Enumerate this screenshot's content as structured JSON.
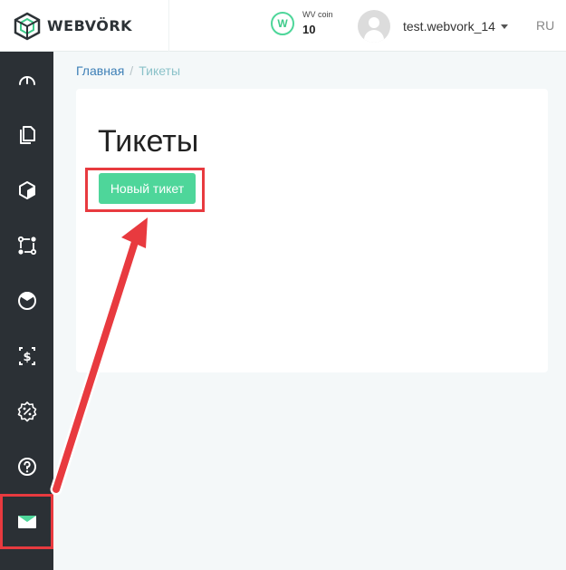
{
  "header": {
    "logo_text": "WEBVÖRK",
    "coin_label": "WV coin",
    "coin_value": "10",
    "coin_badge": "W",
    "username": "test.webvork_14",
    "lang": "RU"
  },
  "sidebar": {
    "items": [
      {
        "icon": "speedometer-icon",
        "active": false
      },
      {
        "icon": "documents-icon",
        "active": false
      },
      {
        "icon": "cube-icon",
        "active": false
      },
      {
        "icon": "flow-icon",
        "active": false
      },
      {
        "icon": "pie-chart-icon",
        "active": false
      },
      {
        "icon": "dollar-icon",
        "active": false
      },
      {
        "icon": "badge-percent-icon",
        "active": false
      },
      {
        "icon": "help-icon",
        "active": false
      },
      {
        "icon": "envelope-icon",
        "active": true
      }
    ]
  },
  "breadcrumb": {
    "home": "Главная",
    "separator": "/",
    "current": "Тикеты"
  },
  "page": {
    "title": "Тикеты",
    "new_ticket_button": "Новый тикет"
  },
  "colors": {
    "accent_green": "#4ed69a",
    "sidebar_bg": "#2b3035",
    "highlight_red": "#e83a3f",
    "link_blue": "#3d7fb6"
  }
}
